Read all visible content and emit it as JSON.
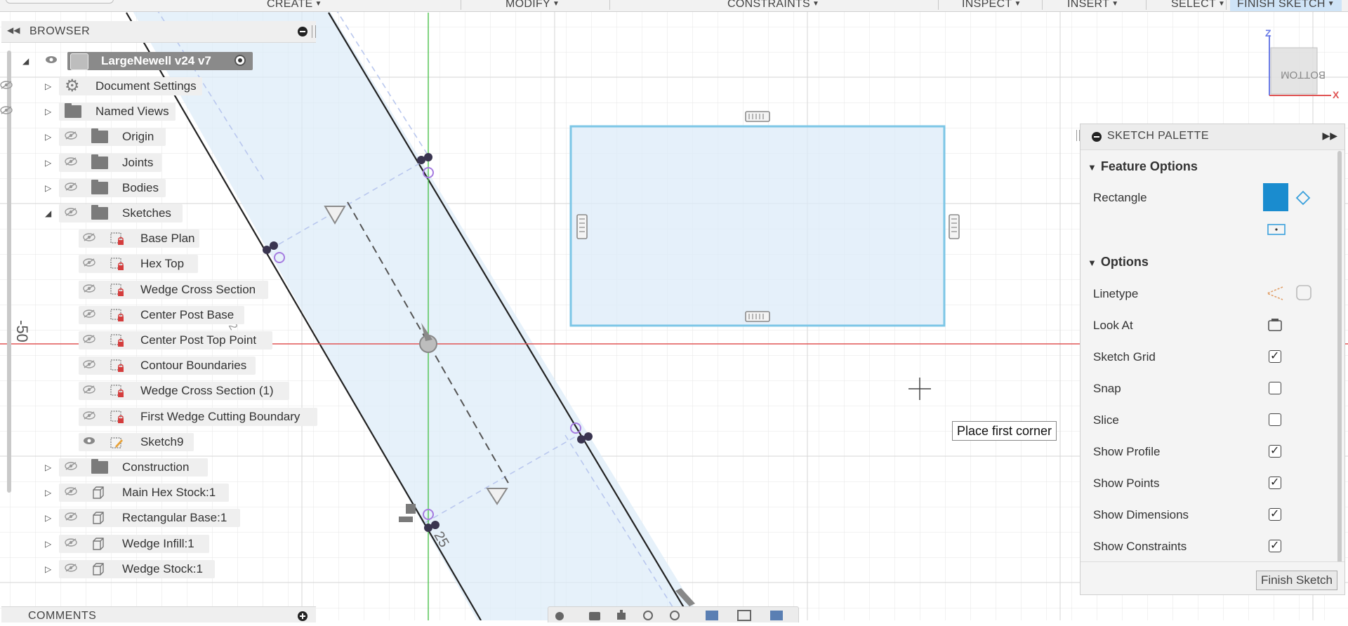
{
  "toolbar": {
    "create": "CREATE",
    "modify": "MODIFY",
    "constraints": "CONSTRAINTS",
    "inspect": "INSPECT",
    "insert": "INSERT",
    "select": "SELECT",
    "finish_sketch": "FINISH SKETCH"
  },
  "browser": {
    "title": "BROWSER",
    "root": "LargeNewell v24 v7",
    "items": [
      {
        "label": "Document Settings",
        "icon": "gear-icon"
      },
      {
        "label": "Named Views",
        "icon": "folder-icon"
      },
      {
        "label": "Origin",
        "icon": "folder-icon"
      },
      {
        "label": "Joints",
        "icon": "folder-icon"
      },
      {
        "label": "Bodies",
        "icon": "folder-icon"
      },
      {
        "label": "Sketches",
        "icon": "folder-icon"
      },
      {
        "label": "Base Plan",
        "icon": "sketch-locked-icon"
      },
      {
        "label": "Hex Top",
        "icon": "sketch-locked-icon"
      },
      {
        "label": "Wedge Cross Section",
        "icon": "sketch-locked-icon"
      },
      {
        "label": "Center Post Base",
        "icon": "sketch-locked-icon"
      },
      {
        "label": "Center Post Top Point",
        "icon": "sketch-locked-icon"
      },
      {
        "label": "Contour Boundaries",
        "icon": "sketch-locked-icon"
      },
      {
        "label": "Wedge Cross Section (1)",
        "icon": "sketch-locked-icon"
      },
      {
        "label": "First Wedge Cutting Boundary",
        "icon": "sketch-locked-icon"
      },
      {
        "label": "Sketch9",
        "icon": "sketch-edit-icon"
      },
      {
        "label": "Construction",
        "icon": "folder-icon"
      },
      {
        "label": "Main Hex Stock:1",
        "icon": "body-icon"
      },
      {
        "label": "Rectangular Base:1",
        "icon": "body-icon"
      },
      {
        "label": "Wedge Infill:1",
        "icon": "body-icon"
      },
      {
        "label": "Wedge Stock:1",
        "icon": "body-icon"
      }
    ]
  },
  "comments": {
    "title": "COMMENTS"
  },
  "canvas": {
    "axis_label": "-50",
    "dim_label": "25",
    "tooltip": "Place first corner",
    "viewcube_face": "BOTTOM",
    "viewcube_z": "Z",
    "viewcube_x": "X"
  },
  "palette": {
    "title": "SKETCH PALETTE",
    "feature_options": "Feature Options",
    "rectangle": "Rectangle",
    "options": "Options",
    "linetype": "Linetype",
    "look_at": "Look At",
    "sketch_grid": "Sketch Grid",
    "snap": "Snap",
    "slice": "Slice",
    "show_profile": "Show Profile",
    "show_points": "Show Points",
    "show_dimensions": "Show Dimensions",
    "show_constraints": "Show Constraints",
    "finish_button": "Finish Sketch",
    "checks": {
      "sketch_grid": true,
      "snap": false,
      "slice": false,
      "show_profile": true,
      "show_points": true,
      "show_dimensions": true,
      "show_constraints": true
    }
  },
  "colors": {
    "accent": "#1a8ccf",
    "sketch_fill": "#dcebf8",
    "rectangle_stroke": "#7cc6e6",
    "axis_red": "#e05555",
    "axis_green": "#4cc24c"
  }
}
